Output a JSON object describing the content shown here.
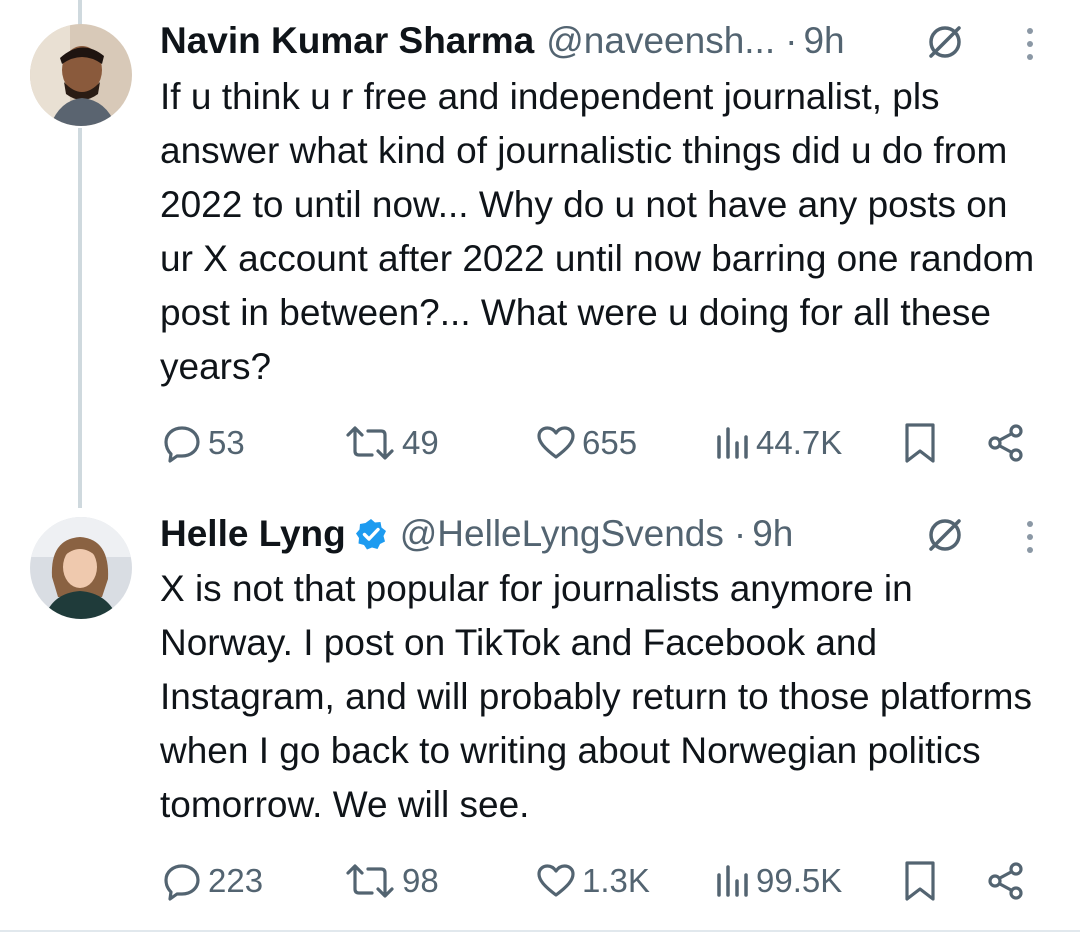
{
  "tweets": [
    {
      "name": "Navin Kumar Sharma",
      "handle": "@naveensh...",
      "dot": "·",
      "time": "9h",
      "verified": false,
      "body": "If u think u r free and independent journalist, pls answer what kind of journalistic things did u do from 2022 to until now... Why do u not have any posts on ur X account after 2022 until now barring one random post in between?... What were u doing for all these years?",
      "replies": "53",
      "reposts": "49",
      "likes": "655",
      "views": "44.7K"
    },
    {
      "name": "Helle Lyng",
      "handle": "@HelleLyngSvends",
      "dot": "·",
      "time": "9h",
      "verified": true,
      "body": "X is not that popular for journalists anymore in Norway. I post on TikTok and Facebook and Instagram, and will probably return to those platforms when I go back to writing about Norwegian politics tomorrow. We will see.",
      "replies": "223",
      "reposts": "98",
      "likes": "1.3K",
      "views": "99.5K"
    }
  ],
  "icons": {
    "reply": "reply-icon",
    "repost": "repost-icon",
    "like": "heart-icon",
    "views": "views-icon",
    "bookmark": "bookmark-icon",
    "share": "share-icon",
    "grok": "grok-icon",
    "more": "more-icon",
    "verified": "verified-badge-icon"
  },
  "colors": {
    "text": "#0f1419",
    "secondary": "#536471",
    "verified": "#1d9bf0",
    "thread_line": "#cfd9de"
  }
}
